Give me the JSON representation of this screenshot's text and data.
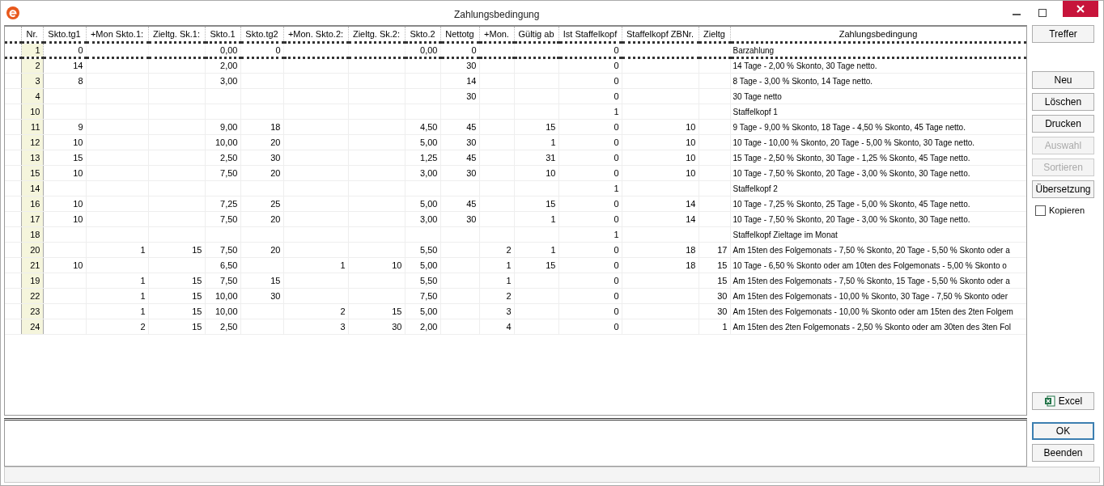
{
  "window": {
    "title": "Zahlungsbedingung"
  },
  "table": {
    "columns": [
      "Nr.",
      "Skto.tg1",
      "+Mon Skto.1:",
      "Zieltg. Sk.1:",
      "Skto.1",
      "Skto.tg2",
      "+Mon. Skto.2:",
      "Zieltg. Sk.2:",
      "Skto.2",
      "Nettotg",
      "+Mon.",
      "Gültig ab",
      "Ist Staffelkopf",
      "Staffelkopf ZBNr.",
      "Zieltg",
      "Zahlungsbedingung"
    ],
    "pinned_row": {
      "nr": "1",
      "skto_tg1": "0",
      "skto_1": "0,00",
      "skto_tg2": "0",
      "skto_2": "0,00",
      "nettotg": "0",
      "ist_staffelkopf": "0",
      "zahlungsbedingung": "Barzahlung"
    },
    "rows": [
      {
        "nr": "2",
        "skto_tg1": "14",
        "skto_1": "2,00",
        "nettotg": "30",
        "ist_staffelkopf": "0",
        "zahlungsbedingung": "14 Tage - 2,00 % Skonto, 30 Tage netto."
      },
      {
        "nr": "3",
        "skto_tg1": "8",
        "skto_1": "3,00",
        "nettotg": "14",
        "ist_staffelkopf": "0",
        "zahlungsbedingung": "8 Tage - 3,00 % Skonto, 14 Tage netto."
      },
      {
        "nr": "4",
        "nettotg": "30",
        "ist_staffelkopf": "0",
        "zahlungsbedingung": "30 Tage netto"
      },
      {
        "nr": "10",
        "ist_staffelkopf": "1",
        "zahlungsbedingung": "Staffelkopf 1"
      },
      {
        "nr": "11",
        "skto_tg1": "9",
        "skto_1": "9,00",
        "skto_tg2": "18",
        "skto_2": "4,50",
        "nettotg": "45",
        "gueltig_ab": "15",
        "ist_staffelkopf": "0",
        "staffelkopf_zbnr": "10",
        "zahlungsbedingung": "9 Tage - 9,00 % Skonto, 18 Tage - 4,50 % Skonto, 45 Tage netto."
      },
      {
        "nr": "12",
        "skto_tg1": "10",
        "skto_1": "10,00",
        "skto_tg2": "20",
        "skto_2": "5,00",
        "nettotg": "30",
        "gueltig_ab": "1",
        "ist_staffelkopf": "0",
        "staffelkopf_zbnr": "10",
        "zahlungsbedingung": "10 Tage - 10,00 % Skonto, 20 Tage - 5,00 % Skonto, 30 Tage netto."
      },
      {
        "nr": "13",
        "skto_tg1": "15",
        "skto_1": "2,50",
        "skto_tg2": "30",
        "skto_2": "1,25",
        "nettotg": "45",
        "gueltig_ab": "31",
        "ist_staffelkopf": "0",
        "staffelkopf_zbnr": "10",
        "zahlungsbedingung": "15 Tage - 2,50 % Skonto, 30 Tage - 1,25 % Skonto, 45 Tage netto."
      },
      {
        "nr": "15",
        "skto_tg1": "10",
        "skto_1": "7,50",
        "skto_tg2": "20",
        "skto_2": "3,00",
        "nettotg": "30",
        "gueltig_ab": "10",
        "ist_staffelkopf": "0",
        "staffelkopf_zbnr": "10",
        "zahlungsbedingung": "10 Tage - 7,50 % Skonto, 20 Tage - 3,00 % Skonto, 30 Tage netto."
      },
      {
        "nr": "14",
        "ist_staffelkopf": "1",
        "zahlungsbedingung": "Staffelkopf 2"
      },
      {
        "nr": "16",
        "skto_tg1": "10",
        "skto_1": "7,25",
        "skto_tg2": "25",
        "skto_2": "5,00",
        "nettotg": "45",
        "gueltig_ab": "15",
        "ist_staffelkopf": "0",
        "staffelkopf_zbnr": "14",
        "zahlungsbedingung": "10 Tage - 7,25 % Skonto, 25 Tage - 5,00 % Skonto, 45 Tage netto."
      },
      {
        "nr": "17",
        "skto_tg1": "10",
        "skto_1": "7,50",
        "skto_tg2": "20",
        "skto_2": "3,00",
        "nettotg": "30",
        "gueltig_ab": "1",
        "ist_staffelkopf": "0",
        "staffelkopf_zbnr": "14",
        "zahlungsbedingung": "10 Tage - 7,50 % Skonto, 20 Tage - 3,00 % Skonto, 30 Tage netto."
      },
      {
        "nr": "18",
        "ist_staffelkopf": "1",
        "zahlungsbedingung": "Staffelkopf Zieltage im Monat"
      },
      {
        "nr": "20",
        "mon_skto_1": "1",
        "zieltg_sk_1": "15",
        "skto_1": "7,50",
        "skto_tg2": "20",
        "skto_2": "5,50",
        "mon": "2",
        "gueltig_ab": "1",
        "ist_staffelkopf": "0",
        "staffelkopf_zbnr": "18",
        "zieltg": "17",
        "zahlungsbedingung": "Am 15ten des Folgemonats - 7,50 % Skonto, 20 Tage - 5,50 % Skonto oder a"
      },
      {
        "nr": "21",
        "skto_tg1": "10",
        "skto_1": "6,50",
        "mon_skto_2": "1",
        "zieltg_sk_2": "10",
        "skto_2": "5,00",
        "mon": "1",
        "gueltig_ab": "15",
        "ist_staffelkopf": "0",
        "staffelkopf_zbnr": "18",
        "zieltg": "15",
        "zahlungsbedingung": "10 Tage - 6,50 % Skonto oder am 10ten des Folgemonats - 5,00 % Skonto o"
      },
      {
        "nr": "19",
        "mon_skto_1": "1",
        "zieltg_sk_1": "15",
        "skto_1": "7,50",
        "skto_tg2": "15",
        "skto_2": "5,50",
        "mon": "1",
        "ist_staffelkopf": "0",
        "zieltg": "15",
        "zahlungsbedingung": "Am 15ten des Folgemonats - 7,50 % Skonto, 15 Tage - 5,50 % Skonto oder a"
      },
      {
        "nr": "22",
        "mon_skto_1": "1",
        "zieltg_sk_1": "15",
        "skto_1": "10,00",
        "skto_tg2": "30",
        "skto_2": "7,50",
        "mon": "2",
        "ist_staffelkopf": "0",
        "zieltg": "30",
        "zahlungsbedingung": "Am 15ten des Folgemonats - 10,00 % Skonto, 30 Tage - 7,50 % Skonto oder"
      },
      {
        "nr": "23",
        "mon_skto_1": "1",
        "zieltg_sk_1": "15",
        "skto_1": "10,00",
        "mon_skto_2": "2",
        "zieltg_sk_2": "15",
        "skto_2": "5,00",
        "mon": "3",
        "ist_staffelkopf": "0",
        "zieltg": "30",
        "zahlungsbedingung": "Am 15ten des Folgemonats - 10,00 % Skonto oder am 15ten des 2ten Folgem"
      },
      {
        "nr": "24",
        "mon_skto_1": "2",
        "zieltg_sk_1": "15",
        "skto_1": "2,50",
        "mon_skto_2": "3",
        "zieltg_sk_2": "30",
        "skto_2": "2,00",
        "mon": "4",
        "ist_staffelkopf": "0",
        "zieltg": "1",
        "zahlungsbedingung": "Am 15ten des 2ten Folgemonats - 2,50 % Skonto oder am 30ten des 3ten Fol"
      }
    ]
  },
  "top_buttons": [
    {
      "kind": "button",
      "label": "Treffer",
      "disabled": false
    }
  ],
  "action_buttons": [
    {
      "kind": "button",
      "label": "Neu",
      "disabled": false
    },
    {
      "kind": "button",
      "label": "Löschen",
      "disabled": false
    },
    {
      "kind": "button",
      "label": "Drucken",
      "disabled": false
    },
    {
      "kind": "button",
      "label": "Auswahl",
      "disabled": true
    },
    {
      "kind": "button",
      "label": "Sortieren",
      "disabled": true
    },
    {
      "kind": "button",
      "label": "Übersetzung",
      "disabled": false
    },
    {
      "kind": "checkbox",
      "label": "Kopieren",
      "checked": false
    }
  ],
  "export_buttons": [
    {
      "kind": "excel",
      "label": "Excel",
      "disabled": false
    }
  ],
  "dialog_buttons": [
    {
      "kind": "button",
      "label": "OK",
      "disabled": false,
      "focused": true
    },
    {
      "kind": "button",
      "label": "Beenden",
      "disabled": false,
      "focused": false
    }
  ]
}
